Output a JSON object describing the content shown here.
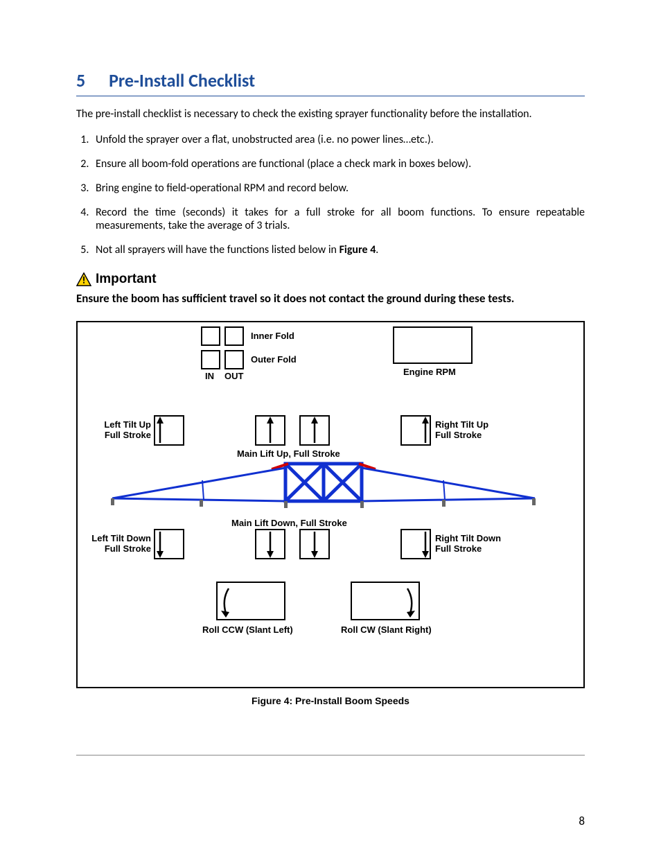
{
  "section": {
    "number": "5",
    "title": "Pre-Install Checklist"
  },
  "intro": "The pre-install checklist is necessary to check the existing sprayer functionality before the installation.",
  "steps": [
    "Unfold the sprayer over a flat, unobstructed area (i.e. no power lines…etc.).",
    "Ensure all boom-fold operations are functional (place a check mark in boxes below).",
    "Bring engine to field-operational RPM and record below.",
    "Record the time (seconds) it takes for a full stroke for all boom functions.  To ensure repeatable measurements, take the average of 3 trials.",
    "Not all sprayers will have the functions listed below in "
  ],
  "figure_ref": "Figure 4",
  "important": {
    "heading": "Important",
    "text": "Ensure the boom has sufficient travel so it does not contact the ground during these tests."
  },
  "figure": {
    "labels": {
      "inner_fold": "Inner Fold",
      "outer_fold": "Outer Fold",
      "in": "IN",
      "out": "OUT",
      "engine_rpm": "Engine RPM",
      "left_tilt_up": "Left Tilt Up",
      "right_tilt_up": "Right Tilt Up",
      "full_stroke": "Full Stroke",
      "main_lift_up": "Main Lift Up, Full Stroke",
      "main_lift_down": "Main Lift Down, Full Stroke",
      "left_tilt_down": "Left Tilt Down",
      "right_tilt_down": "Right Tilt  Down",
      "roll_ccw": "Roll CCW (Slant Left)",
      "roll_cw": "Roll CW (Slant Right)"
    },
    "caption": "Figure 4: Pre-Install Boom Speeds"
  },
  "page_number": "8"
}
